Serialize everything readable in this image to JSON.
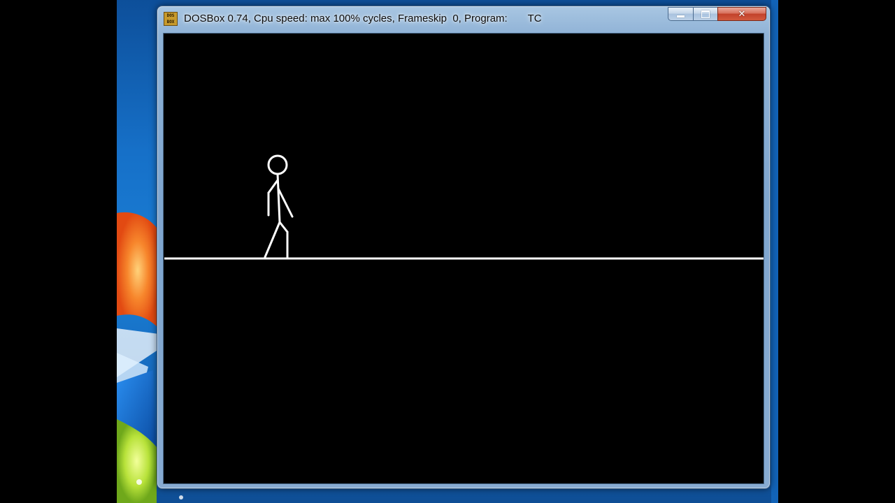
{
  "window": {
    "title": "DOSBox 0.74, Cpu speed: max 100% cycles, Frameskip  0, Program:       TC",
    "icon": "dosbox-icon",
    "icon_text": "DOS BOX",
    "controls": {
      "minimize": "minimize-icon",
      "maximize": "maximize-icon",
      "close": "close-icon",
      "close_glyph": "✕"
    }
  },
  "scene": {
    "background": "#000000",
    "stroke": "#ffffff",
    "figure": "stick-figure-walking",
    "ground": "ground-line"
  },
  "desktop": {
    "wallpaper": "windows-7-logo-wallpaper"
  }
}
